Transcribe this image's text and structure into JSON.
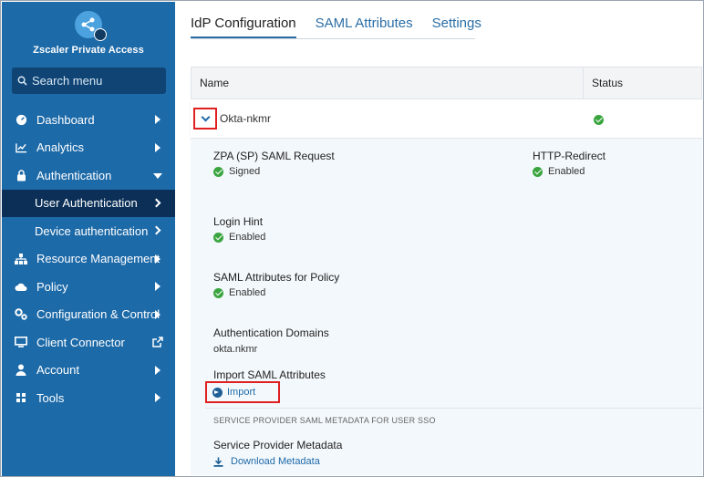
{
  "sidebar": {
    "brand": "Zscaler Private Access",
    "search_placeholder": "Search menu",
    "items": [
      {
        "label": "Dashboard"
      },
      {
        "label": "Analytics"
      },
      {
        "label": "Authentication"
      },
      {
        "label": "User Authentication"
      },
      {
        "label": "Device authentication"
      },
      {
        "label": "Resource Management"
      },
      {
        "label": "Policy"
      },
      {
        "label": "Configuration & Control"
      },
      {
        "label": "Client Connector"
      },
      {
        "label": "Account"
      },
      {
        "label": "Tools"
      }
    ]
  },
  "tabs": [
    {
      "label": "IdP Configuration"
    },
    {
      "label": "SAML Attributes"
    },
    {
      "label": "Settings"
    }
  ],
  "table": {
    "columns": [
      "Name",
      "Status"
    ],
    "row": {
      "name": "Okta-nkmr"
    }
  },
  "details": {
    "zpa_label": "ZPA (SP) SAML Request",
    "zpa_value": "Signed",
    "http_label": "HTTP-Redirect",
    "http_value": "Enabled",
    "login_label": "Login Hint",
    "login_value": "Enabled",
    "saml_policy_label": "SAML Attributes for Policy",
    "saml_policy_value": "Enabled",
    "auth_domains_label": "Authentication Domains",
    "auth_domains_value": "okta.nkmr",
    "import_label": "Import SAML Attributes",
    "import_button": "Import",
    "sp_section": "SERVICE PROVIDER SAML METADATA FOR USER SSO",
    "sp_label": "Service Provider Metadata",
    "download": "Download Metadata"
  },
  "colors": {
    "sidebar": "#1d6aa8",
    "active_item": "#0b2f56",
    "accent": "#1f6aa8",
    "success": "#3aa53f",
    "highlight": "#e02020"
  }
}
